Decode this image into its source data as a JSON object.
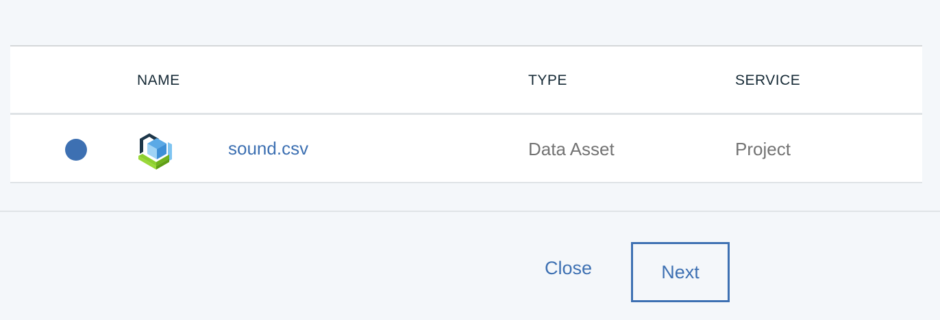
{
  "table": {
    "headers": {
      "name": "NAME",
      "type": "TYPE",
      "service": "SERVICE"
    },
    "rows": [
      {
        "name": "sound.csv",
        "type": "Data Asset",
        "service": "Project",
        "icon": "data-asset-cube-icon",
        "selected": true
      }
    ]
  },
  "footer": {
    "close_label": "Close",
    "next_label": "Next"
  },
  "colors": {
    "accent": "#3d70b2",
    "header_text": "#152935",
    "muted_text": "#737373",
    "background": "#f4f7fa"
  }
}
